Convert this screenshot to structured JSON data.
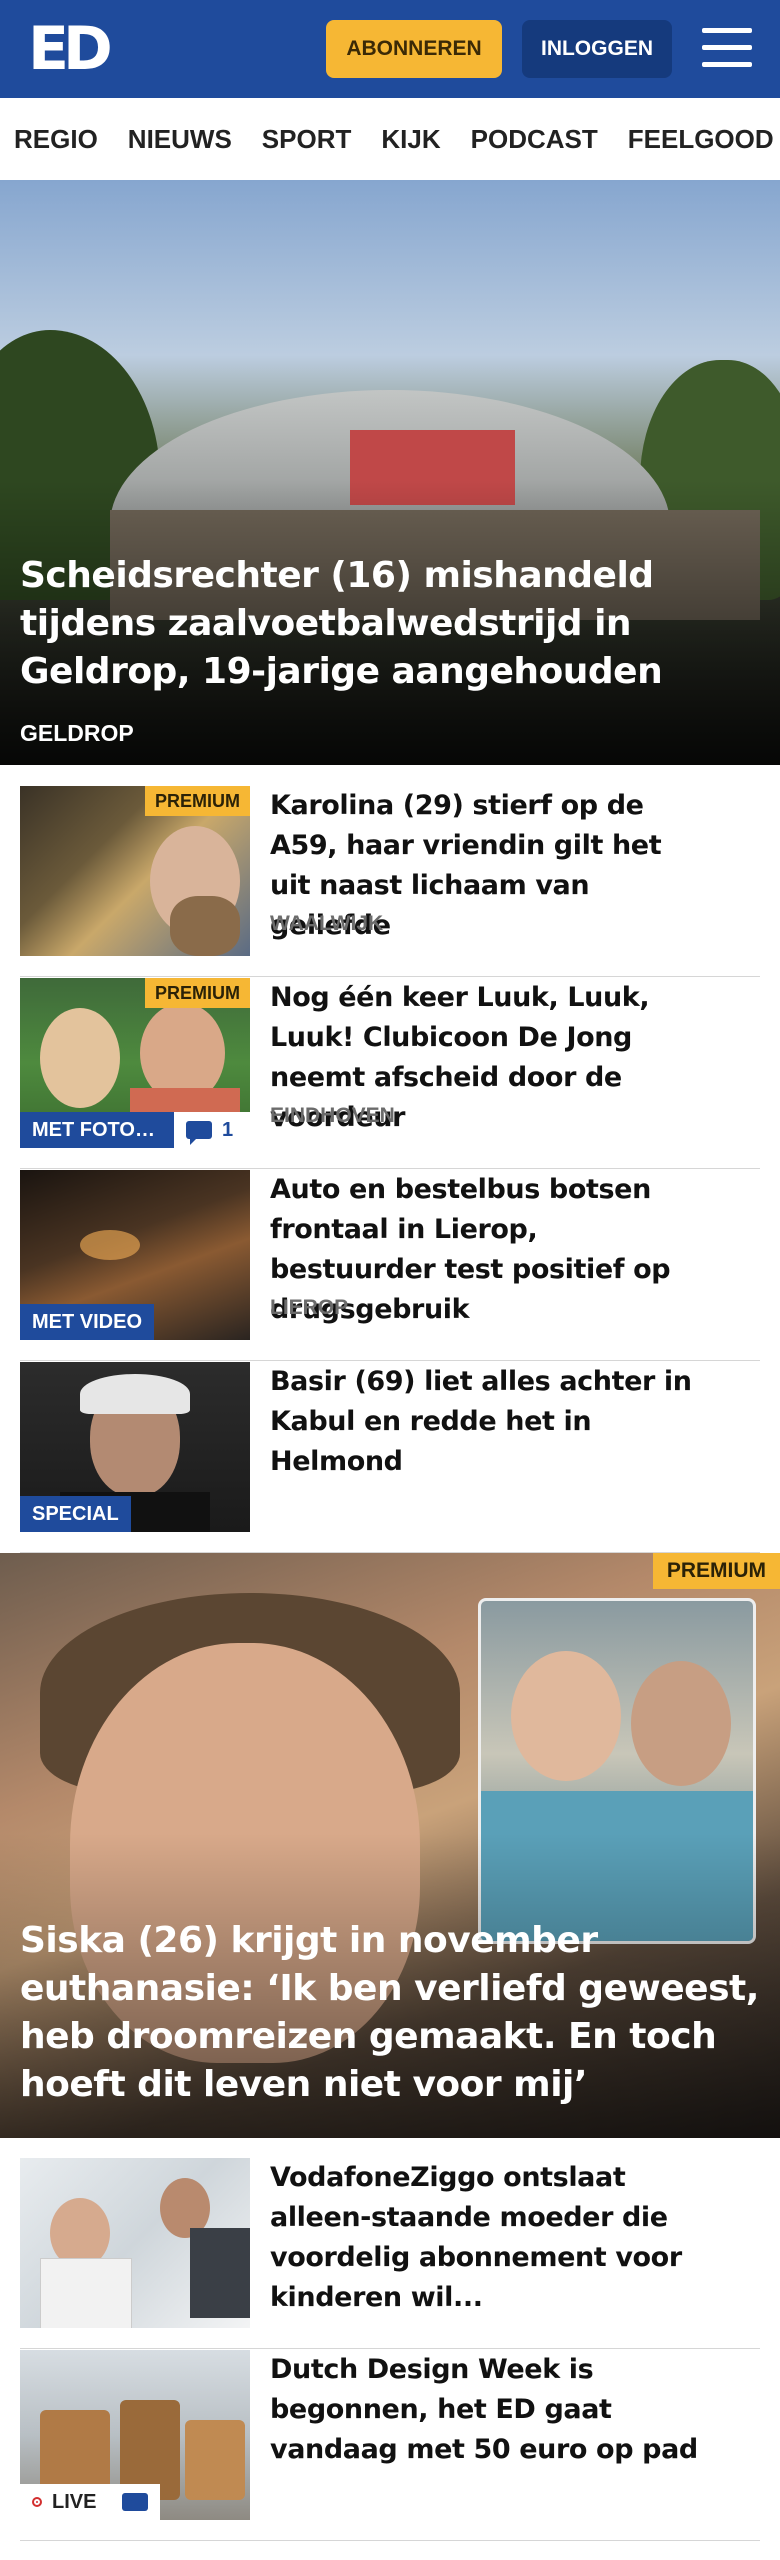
{
  "header": {
    "logo": "ED",
    "subscribe_label": "ABONNEREN",
    "login_label": "INLOGGEN",
    "menu_icon": "hamburger-menu-icon"
  },
  "nav": {
    "items": [
      "REGIO",
      "NIEUWS",
      "SPORT",
      "KIJK",
      "PODCAST",
      "FEELGOOD"
    ]
  },
  "hero": {
    "title": "Scheidsrechter (16) mishandeld tijdens zaalvoetbalwedstrijd in Geldrop, 19-jarige aangehouden",
    "location": "GELDROP"
  },
  "articles": [
    {
      "title": "Karolina (29) stierf op de A59, haar vriendin gilt het uit naast lichaam van geliefde",
      "location": "WAALWIJK",
      "premium": "PREMIUM"
    },
    {
      "title": "Nog één keer Luuk, Luuk, Luuk! Clubicoon De Jong neemt afscheid door de voordeur",
      "location": "EINDHOVEN",
      "premium": "PREMIUM",
      "badge": "MET FOTOG...",
      "comments": "1"
    },
    {
      "title": "Auto en bestelbus botsen frontaal in Lierop, bestuurder test positief op drugsgebruik",
      "location": "LIEROP",
      "badge": "MET VIDEO"
    },
    {
      "title": "Basir (69) liet alles achter in Kabul en redde het in Helmond",
      "badge": "SPECIAL"
    }
  ],
  "feature": {
    "title": "Siska (26) krijgt in november euthanasie: ‘Ik ben verliefd geweest, heb droomreizen gemaakt. En toch hoeft dit leven niet voor mij’",
    "premium": "PREMIUM"
  },
  "articles2": [
    {
      "title": "VodafoneZiggo ontslaat alleen-staande moeder die voordelig abonnement voor kinderen wil..."
    },
    {
      "title": "Dutch Design Week is begonnen, het ED gaat vandaag met 50 euro op pad",
      "live": "LIVE"
    }
  ],
  "colors": {
    "brand_blue": "#1f4b9c",
    "premium_yellow": "#f6b734",
    "live_red": "#d32f2f"
  }
}
